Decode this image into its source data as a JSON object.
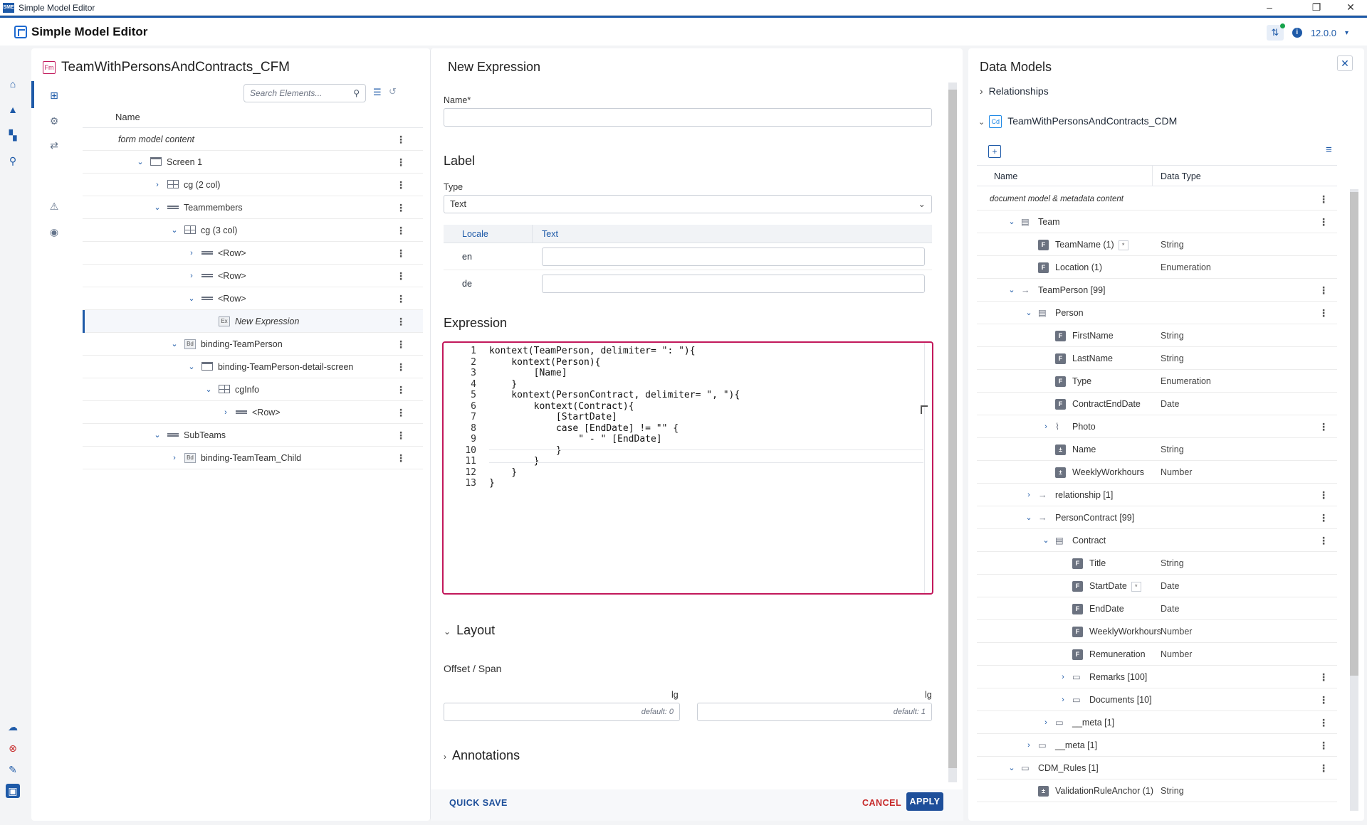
{
  "window": {
    "title": "Simple Model Editor",
    "min_icon": "–",
    "max_icon": "❐",
    "close_icon": "✕"
  },
  "app": {
    "title": "Simple Model Editor",
    "version": "12.0.0"
  },
  "form_panel": {
    "badge": "Fm",
    "title": "TeamWithPersonsAndContracts_CFM",
    "search_placeholder": "Search Elements...",
    "column_name": "Name",
    "tree": [
      {
        "label": "form model content",
        "italic": true,
        "indent": 0,
        "chev": "",
        "icon": ""
      },
      {
        "label": "Screen 1",
        "indent": 1,
        "chev": "down",
        "icon": "screen"
      },
      {
        "label": "cg (2 col)",
        "indent": 2,
        "chev": "right",
        "icon": "grid"
      },
      {
        "label": "Teammembers",
        "indent": 2,
        "chev": "down",
        "icon": "bar"
      },
      {
        "label": "cg (3 col)",
        "indent": 3,
        "chev": "down",
        "icon": "grid"
      },
      {
        "label": "<Row>",
        "indent": 4,
        "chev": "right",
        "icon": "bar"
      },
      {
        "label": "<Row>",
        "indent": 4,
        "chev": "right",
        "icon": "bar"
      },
      {
        "label": "<Row>",
        "indent": 4,
        "chev": "down",
        "icon": "bar"
      },
      {
        "label": "New Expression",
        "italic": true,
        "indent": 5,
        "chev": "",
        "icon": "ex",
        "selected": true
      },
      {
        "label": "binding-TeamPerson",
        "indent": 3,
        "chev": "down",
        "icon": "bd"
      },
      {
        "label": "binding-TeamPerson-detail-screen",
        "indent": 4,
        "chev": "down",
        "icon": "screen"
      },
      {
        "label": "cgInfo",
        "indent": 5,
        "chev": "down",
        "icon": "grid"
      },
      {
        "label": "<Row>",
        "indent": 6,
        "chev": "right",
        "icon": "bar"
      },
      {
        "label": "SubTeams",
        "indent": 2,
        "chev": "down",
        "icon": "bar"
      },
      {
        "label": "binding-TeamTeam_Child",
        "indent": 3,
        "chev": "right",
        "icon": "bd"
      }
    ]
  },
  "expression_panel": {
    "title": "New Expression",
    "name_label": "Name*",
    "name_value": "",
    "label_heading": "Label",
    "type_label": "Type",
    "type_value": "Text",
    "locale_header": "Locale",
    "text_header": "Text",
    "locales": [
      "en",
      "de"
    ],
    "expression_heading": "Expression",
    "code_lines": [
      "kontext(TeamPerson, delimiter= \": \"){",
      "    kontext(Person){",
      "        [Name]",
      "    }",
      "    kontext(PersonContract, delimiter= \", \"){",
      "        kontext(Contract){",
      "            [StartDate]",
      "            case [EndDate] != \"\" {",
      "                \" - \" [EndDate]",
      "            }",
      "        }",
      "    }",
      "}"
    ],
    "layout_heading": "Layout",
    "offset_span_label": "Offset / Span",
    "lg_label_1": "lg",
    "lg_label_2": "lg",
    "offset_placeholder": "default: 0",
    "span_placeholder": "default: 1",
    "annotations_heading": "Annotations",
    "quick_save": "QUICK SAVE",
    "cancel": "CANCEL",
    "apply": "APPLY"
  },
  "data_models": {
    "title": "Data Models",
    "relationships": "Relationships",
    "model_badge": "Cd",
    "model_name": "TeamWithPersonsAndContracts_CDM",
    "col_name": "Name",
    "col_type": "Data Type",
    "rows": [
      {
        "label": "document model & metadata content",
        "italic": true,
        "indent": 0,
        "chev": "",
        "icon": "",
        "type": "",
        "kebab": true
      },
      {
        "label": "Team",
        "indent": 1,
        "chev": "down",
        "icon": "doc",
        "type": "",
        "kebab": true
      },
      {
        "label": "TeamName (1)",
        "indent": 2,
        "chev": "",
        "icon": "F",
        "type": "String",
        "star": true
      },
      {
        "label": "Location (1)",
        "indent": 2,
        "chev": "",
        "icon": "F",
        "type": "Enumeration"
      },
      {
        "label": "TeamPerson [99]",
        "indent": 1,
        "chev": "down",
        "icon": "arrow",
        "type": "",
        "kebab": true
      },
      {
        "label": "Person",
        "indent": 2,
        "chev": "down",
        "icon": "doc",
        "type": "",
        "kebab": true
      },
      {
        "label": "FirstName",
        "indent": 3,
        "chev": "",
        "icon": "F",
        "type": "String"
      },
      {
        "label": "LastName",
        "indent": 3,
        "chev": "",
        "icon": "F",
        "type": "String"
      },
      {
        "label": "Type",
        "indent": 3,
        "chev": "",
        "icon": "F",
        "type": "Enumeration"
      },
      {
        "label": "ContractEndDate",
        "indent": 3,
        "chev": "",
        "icon": "F",
        "type": "Date"
      },
      {
        "label": "Photo",
        "indent": 3,
        "chev": "right",
        "icon": "clip",
        "type": "",
        "kebab": true
      },
      {
        "label": "Name",
        "indent": 3,
        "chev": "",
        "icon": "pm",
        "type": "String"
      },
      {
        "label": "WeeklyWorkhours",
        "indent": 3,
        "chev": "",
        "icon": "pm",
        "type": "Number"
      },
      {
        "label": "relationship [1]",
        "indent": 2,
        "chev": "right",
        "icon": "arrow",
        "type": "",
        "kebab": true
      },
      {
        "label": "PersonContract [99]",
        "indent": 2,
        "chev": "down",
        "icon": "arrow",
        "type": "",
        "kebab": true
      },
      {
        "label": "Contract",
        "indent": 3,
        "chev": "down",
        "icon": "doc",
        "type": "",
        "kebab": true
      },
      {
        "label": "Title",
        "indent": 4,
        "chev": "",
        "icon": "F",
        "type": "String"
      },
      {
        "label": "StartDate",
        "indent": 4,
        "chev": "",
        "icon": "F",
        "type": "Date",
        "star": true
      },
      {
        "label": "EndDate",
        "indent": 4,
        "chev": "",
        "icon": "F",
        "type": "Date"
      },
      {
        "label": "WeeklyWorkhours",
        "indent": 4,
        "chev": "",
        "icon": "F",
        "type": "Number"
      },
      {
        "label": "Remuneration",
        "indent": 4,
        "chev": "",
        "icon": "F",
        "type": "Number"
      },
      {
        "label": "Remarks [100]",
        "indent": 4,
        "chev": "right",
        "icon": "folder",
        "type": "",
        "kebab": true
      },
      {
        "label": "Documents [10]",
        "indent": 4,
        "chev": "right",
        "icon": "folder",
        "type": "",
        "kebab": true
      },
      {
        "label": "__meta [1]",
        "indent": 3,
        "chev": "right",
        "icon": "md",
        "type": "",
        "kebab": true
      },
      {
        "label": "__meta [1]",
        "indent": 2,
        "chev": "right",
        "icon": "md",
        "type": "",
        "kebab": true
      },
      {
        "label": "CDM_Rules [1]",
        "indent": 1,
        "chev": "down",
        "icon": "folder",
        "type": "",
        "kebab": true
      },
      {
        "label": "ValidationRuleAnchor (1)",
        "indent": 2,
        "chev": "",
        "icon": "pm",
        "type": "String"
      }
    ]
  },
  "colors": {
    "accent": "#1e5aa8",
    "editor_border": "#c2185b",
    "cancel": "#c62828"
  }
}
